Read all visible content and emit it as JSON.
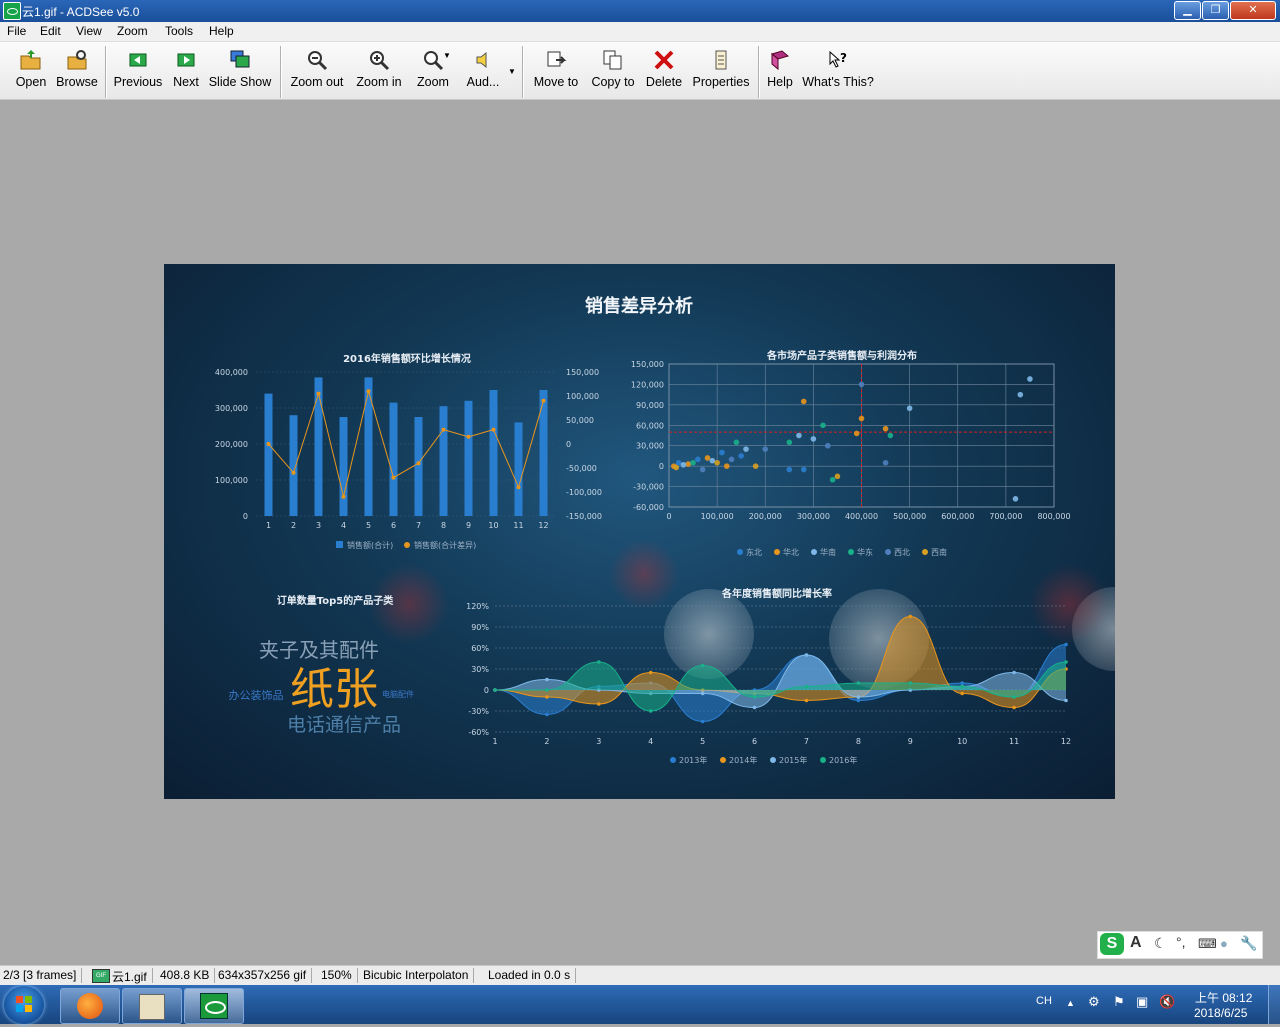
{
  "window": {
    "title": "云1.gif - ACDSee v5.0",
    "buttons": [
      "minimize",
      "maximize",
      "close"
    ]
  },
  "menu": [
    "File",
    "Edit",
    "View",
    "Zoom",
    "Tools",
    "Help"
  ],
  "toolbar": [
    {
      "label": "Open",
      "icon": "open-folder-icon"
    },
    {
      "label": "Browse",
      "icon": "browse-icon"
    },
    {
      "label": "Previous",
      "icon": "previous-arrow-icon"
    },
    {
      "label": "Next",
      "icon": "next-arrow-icon"
    },
    {
      "label": "Slide Show",
      "icon": "slideshow-icon"
    },
    {
      "label": "Zoom out",
      "icon": "zoom-out-icon"
    },
    {
      "label": "Zoom in",
      "icon": "zoom-in-icon"
    },
    {
      "label": "Zoom",
      "icon": "zoom-icon"
    },
    {
      "label": "Aud...",
      "icon": "audio-icon"
    },
    {
      "label": "Move to",
      "icon": "move-to-icon"
    },
    {
      "label": "Copy to",
      "icon": "copy-to-icon"
    },
    {
      "label": "Delete",
      "icon": "delete-x-icon"
    },
    {
      "label": "Properties",
      "icon": "properties-icon"
    },
    {
      "label": "Help",
      "icon": "help-book-icon"
    },
    {
      "label": "What's This?",
      "icon": "whats-this-icon"
    }
  ],
  "dashboard": {
    "title": "销售差异分析",
    "word_cloud": {
      "title": "订单数量Top5的产品子类",
      "words": [
        "夹子及其配件",
        "办公装饰品",
        "纸张",
        "电脑配件",
        "电话通信产品"
      ]
    }
  },
  "chart_data": [
    {
      "type": "bar",
      "title": "2016年销售额环比增长情况",
      "categories": [
        "1",
        "2",
        "3",
        "4",
        "5",
        "6",
        "7",
        "8",
        "9",
        "10",
        "11",
        "12"
      ],
      "ylim": [
        0,
        400000
      ],
      "y_ticks": [
        "400,000",
        "300,000",
        "200,000",
        "100,000",
        "0"
      ],
      "y2lim": [
        -150000,
        150000
      ],
      "y2_ticks": [
        "150,000",
        "100,000",
        "50,000",
        "0",
        "-50,000",
        "-100,000",
        "-150,000"
      ],
      "series": [
        {
          "name": "销售额(合计)",
          "type": "bar",
          "color": "#2a7ed0",
          "values": [
            340000,
            280000,
            385000,
            275000,
            385000,
            315000,
            275000,
            305000,
            320000,
            350000,
            260000,
            350000
          ]
        },
        {
          "name": "销售额(合计差异)",
          "type": "line",
          "axis": "y2",
          "color": "#e8951c",
          "values": [
            0,
            -60000,
            105000,
            -110000,
            110000,
            -70000,
            -40000,
            30000,
            15000,
            30000,
            -90000,
            90000
          ]
        }
      ]
    },
    {
      "type": "scatter",
      "title": "各市场产品子类销售额与利润分布",
      "xlim": [
        0,
        800000
      ],
      "x_ticks": [
        "0",
        "100,000",
        "200,000",
        "300,000",
        "400,000",
        "500,000",
        "600,000",
        "700,000",
        "800,000"
      ],
      "ylim": [
        -60000,
        150000
      ],
      "y_ticks": [
        "150,000",
        "120,000",
        "90,000",
        "60,000",
        "30,000",
        "0",
        "-30,000",
        "-60,000"
      ],
      "reference_lines": {
        "x": 400000,
        "y": 50000,
        "color": "#d42020"
      },
      "series": [
        {
          "name": "东北",
          "color": "#2a7ed0",
          "points": [
            [
              20000,
              5000
            ],
            [
              60000,
              10000
            ],
            [
              110000,
              20000
            ],
            [
              150000,
              15000
            ],
            [
              250000,
              -5000
            ],
            [
              280000,
              -5000
            ]
          ]
        },
        {
          "name": "华北",
          "color": "#e8951c",
          "points": [
            [
              10000,
              0
            ],
            [
              40000,
              3000
            ],
            [
              80000,
              12000
            ],
            [
              120000,
              0
            ],
            [
              280000,
              95000
            ],
            [
              390000,
              48000
            ],
            [
              400000,
              70000
            ],
            [
              450000,
              55000
            ]
          ]
        },
        {
          "name": "华南",
          "color": "#7fb8e8",
          "points": [
            [
              30000,
              2000
            ],
            [
              90000,
              8000
            ],
            [
              160000,
              25000
            ],
            [
              270000,
              45000
            ],
            [
              300000,
              40000
            ],
            [
              500000,
              85000
            ],
            [
              730000,
              105000
            ],
            [
              750000,
              128000
            ],
            [
              720000,
              -48000
            ]
          ]
        },
        {
          "name": "华东",
          "color": "#19b08a",
          "points": [
            [
              50000,
              5000
            ],
            [
              140000,
              35000
            ],
            [
              250000,
              35000
            ],
            [
              320000,
              60000
            ],
            [
              340000,
              -20000
            ],
            [
              460000,
              45000
            ]
          ]
        },
        {
          "name": "西北",
          "color": "#4f7fbf",
          "points": [
            [
              70000,
              -5000
            ],
            [
              130000,
              10000
            ],
            [
              200000,
              25000
            ],
            [
              330000,
              30000
            ],
            [
              400000,
              120000
            ],
            [
              450000,
              5000
            ]
          ]
        },
        {
          "name": "西南",
          "color": "#d8a020",
          "points": [
            [
              15000,
              -2000
            ],
            [
              100000,
              5000
            ],
            [
              180000,
              0
            ],
            [
              350000,
              -15000
            ]
          ]
        }
      ]
    },
    {
      "type": "area",
      "title": "各年度销售额同比增长率",
      "categories": [
        "1",
        "2",
        "3",
        "4",
        "5",
        "6",
        "7",
        "8",
        "9",
        "10",
        "11",
        "12"
      ],
      "ylim": [
        -60,
        120
      ],
      "y_ticks": [
        "120%",
        "90%",
        "60%",
        "30%",
        "0",
        "-30%",
        "-60%"
      ],
      "series": [
        {
          "name": "2013年",
          "color": "#2a7ed0",
          "values": [
            0,
            -35,
            5,
            10,
            -45,
            0,
            50,
            -15,
            0,
            10,
            -10,
            65
          ]
        },
        {
          "name": "2014年",
          "color": "#e8951c",
          "values": [
            0,
            -10,
            -20,
            25,
            0,
            -5,
            -15,
            -10,
            105,
            -5,
            -25,
            30
          ]
        },
        {
          "name": "2015年",
          "color": "#7fb8e8",
          "values": [
            0,
            15,
            0,
            -5,
            -5,
            -25,
            50,
            -10,
            0,
            5,
            25,
            -15
          ]
        },
        {
          "name": "2016年",
          "color": "#19b08a",
          "values": [
            0,
            0,
            40,
            -30,
            35,
            -10,
            5,
            10,
            10,
            5,
            -10,
            40
          ]
        }
      ]
    }
  ],
  "status": [
    "2/3 [3 frames]",
    "云1.gif",
    "408.8 KB",
    "634x357x256 gif",
    "150%",
    "Bicubic Interpolaton",
    "Loaded in 0.0 s"
  ],
  "taskbar": {
    "ime_lang": "CH",
    "time": "上午 08:12",
    "date": "2018/6/25"
  }
}
